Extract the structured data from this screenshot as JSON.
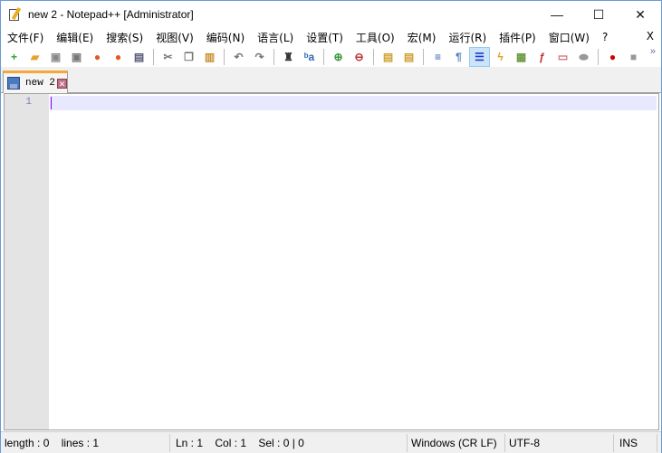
{
  "window": {
    "title": "new 2 - Notepad++ [Administrator]",
    "minimize": "—",
    "maximize": "☐",
    "close": "✕"
  },
  "menu": {
    "items": [
      "文件(F)",
      "编辑(E)",
      "搜索(S)",
      "视图(V)",
      "编码(N)",
      "语言(L)",
      "设置(T)",
      "工具(O)",
      "宏(M)",
      "运行(R)",
      "插件(P)",
      "窗口(W)",
      "?"
    ],
    "close": "X"
  },
  "toolbar": {
    "more": "»",
    "items": [
      {
        "name": "new-file",
        "glyph": "+",
        "color": "#3a9a3a"
      },
      {
        "name": "open-file",
        "glyph": "▰",
        "color": "#e8a030"
      },
      {
        "name": "save",
        "glyph": "▣",
        "color": "#888"
      },
      {
        "name": "save-all",
        "glyph": "▣",
        "color": "#777"
      },
      {
        "name": "close",
        "glyph": "●",
        "color": "#e05a20"
      },
      {
        "name": "close-all",
        "glyph": "●",
        "color": "#e05a20"
      },
      {
        "name": "print",
        "glyph": "▤",
        "color": "#557"
      },
      "sep",
      {
        "name": "cut",
        "glyph": "✂",
        "color": "#777"
      },
      {
        "name": "copy",
        "glyph": "❐",
        "color": "#777"
      },
      {
        "name": "paste",
        "glyph": "▥",
        "color": "#c89030"
      },
      "sep",
      {
        "name": "undo",
        "glyph": "↶",
        "color": "#777"
      },
      {
        "name": "redo",
        "glyph": "↷",
        "color": "#777"
      },
      "sep",
      {
        "name": "find",
        "glyph": "♜",
        "color": "#333"
      },
      {
        "name": "replace",
        "glyph": "ᵇa",
        "color": "#2a6ab0"
      },
      "sep",
      {
        "name": "zoom-in",
        "glyph": "⊕",
        "color": "#3a9a3a"
      },
      {
        "name": "zoom-out",
        "glyph": "⊖",
        "color": "#c03030"
      },
      "sep",
      {
        "name": "sync-vertical",
        "glyph": "▤",
        "color": "#d0a030"
      },
      {
        "name": "sync-horizontal",
        "glyph": "▤",
        "color": "#d0a030"
      },
      "sep",
      {
        "name": "word-wrap",
        "glyph": "≡",
        "color": "#2a5ab0"
      },
      {
        "name": "show-all-chars",
        "glyph": "¶",
        "color": "#4a7ac0"
      },
      {
        "name": "indent-guide",
        "glyph": "☰",
        "color": "#1a3ad0",
        "active": true
      },
      {
        "name": "user-defined-language",
        "glyph": "ϟ",
        "color": "#e0a020"
      },
      {
        "name": "document-map",
        "glyph": "▦",
        "color": "#6a9a40"
      },
      {
        "name": "function-list",
        "glyph": "ƒ",
        "color": "#c03030"
      },
      {
        "name": "folder-workspace",
        "glyph": "▭",
        "color": "#d07070"
      },
      {
        "name": "monitoring",
        "glyph": "⬬",
        "color": "#999"
      },
      "sep",
      {
        "name": "record-macro",
        "glyph": "●",
        "color": "#d00000"
      },
      {
        "name": "stop-recording",
        "glyph": "■",
        "color": "#999"
      }
    ]
  },
  "tab": {
    "label": "new 2",
    "close": "✕"
  },
  "editor": {
    "line_number": "1"
  },
  "status": {
    "length": "length : 0    lines : 1",
    "position": "Ln : 1    Col : 1    Sel : 0 | 0",
    "eol": "Windows (CR LF)",
    "encoding": "UTF-8",
    "mode": "INS"
  }
}
